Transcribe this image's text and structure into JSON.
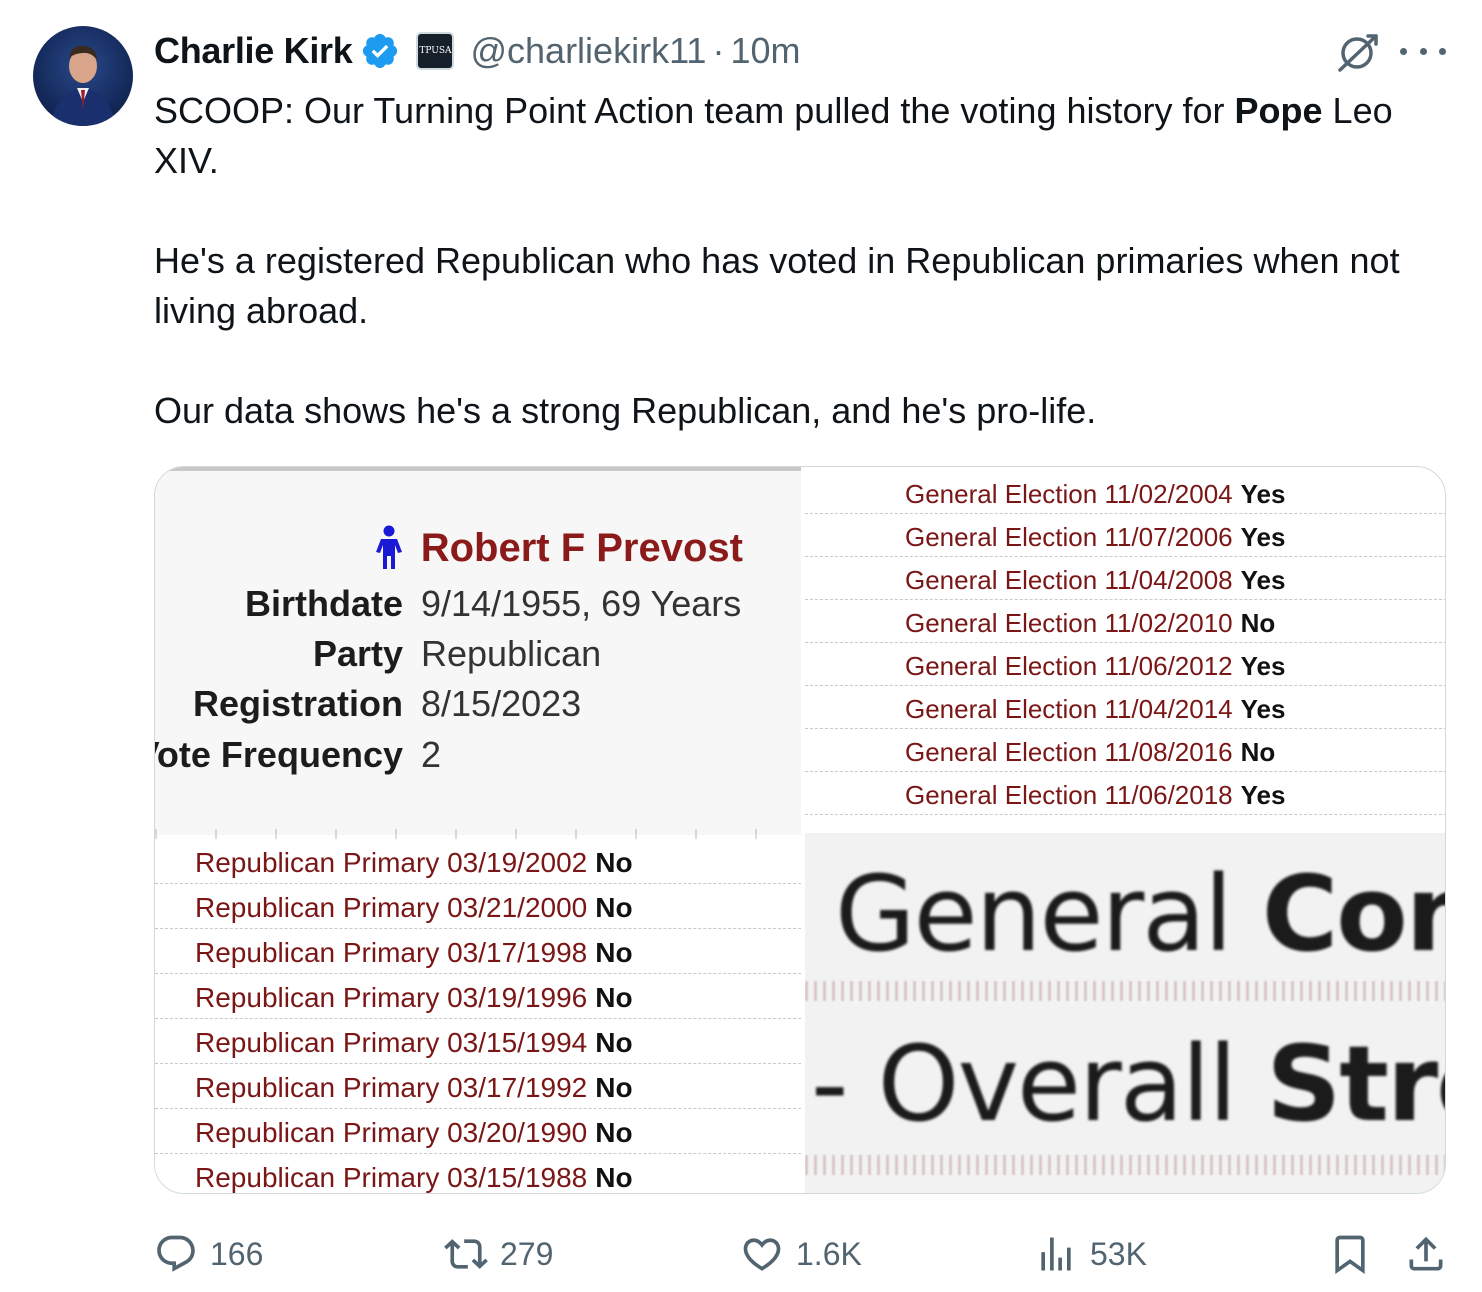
{
  "author": {
    "name": "Charlie Kirk",
    "handle": "@charliekirk11",
    "separator": "·",
    "time": "10m",
    "verified_icon": "verified-badge-icon",
    "affiliation_icon": "affiliation-logo-icon",
    "affiliation_text": "TPUSA"
  },
  "tweet": {
    "line1_pre": "SCOOP: Our Turning Point Action team pulled the voting history for ",
    "line1_bold": "Pope",
    "line1_post": " Leo XIV.",
    "para2": "He's a registered Republican who has voted in Republican primaries when not living abroad.",
    "para3": "Our data shows he's a strong Republican, and he's pro-life."
  },
  "media": {
    "person_name": "Robert F Prevost",
    "profile": [
      {
        "label": "Birthdate",
        "value": "9/14/1955, 69 Years"
      },
      {
        "label": "Party",
        "value": "Republican"
      },
      {
        "label": "Registration",
        "value": "8/15/2023"
      },
      {
        "label": "Vote Frequency",
        "value": "2"
      }
    ],
    "general_elections": [
      {
        "label": "General Election 11/02/2004",
        "answer": "Yes"
      },
      {
        "label": "General Election 11/07/2006",
        "answer": "Yes"
      },
      {
        "label": "General Election 11/04/2008",
        "answer": "Yes"
      },
      {
        "label": "General Election 11/02/2010",
        "answer": "No"
      },
      {
        "label": "General Election 11/06/2012",
        "answer": "Yes"
      },
      {
        "label": "General Election 11/04/2014",
        "answer": "Yes"
      },
      {
        "label": "General Election 11/08/2016",
        "answer": "No"
      },
      {
        "label": "General Election 11/06/2018",
        "answer": "Yes"
      }
    ],
    "republican_primaries": [
      {
        "label": "Republican Primary 03/19/2002",
        "answer": "No"
      },
      {
        "label": "Republican Primary 03/21/2000",
        "answer": "No"
      },
      {
        "label": "Republican Primary 03/17/1998",
        "answer": "No"
      },
      {
        "label": "Republican Primary 03/19/1996",
        "answer": "No"
      },
      {
        "label": "Republican Primary 03/15/1994",
        "answer": "No"
      },
      {
        "label": "Republican Primary 03/17/1992",
        "answer": "No"
      },
      {
        "label": "Republican Primary 03/20/1990",
        "answer": "No"
      },
      {
        "label": "Republican Primary 03/15/1988",
        "answer": "No"
      }
    ],
    "zoom_line1_a": "General",
    "zoom_line1_b": "Cons",
    "zoom_line2_a": "Overall",
    "zoom_line2_b": "Stro"
  },
  "actions": {
    "replies": "166",
    "reposts": "279",
    "likes": "1.6K",
    "views": "53K"
  },
  "colors": {
    "text": "#0f1419",
    "secondary": "#536471",
    "verified": "#1d9bf0",
    "record_label": "#7a1616",
    "person_name": "#8b1a1a",
    "person_icon": "#1a1ad6"
  }
}
